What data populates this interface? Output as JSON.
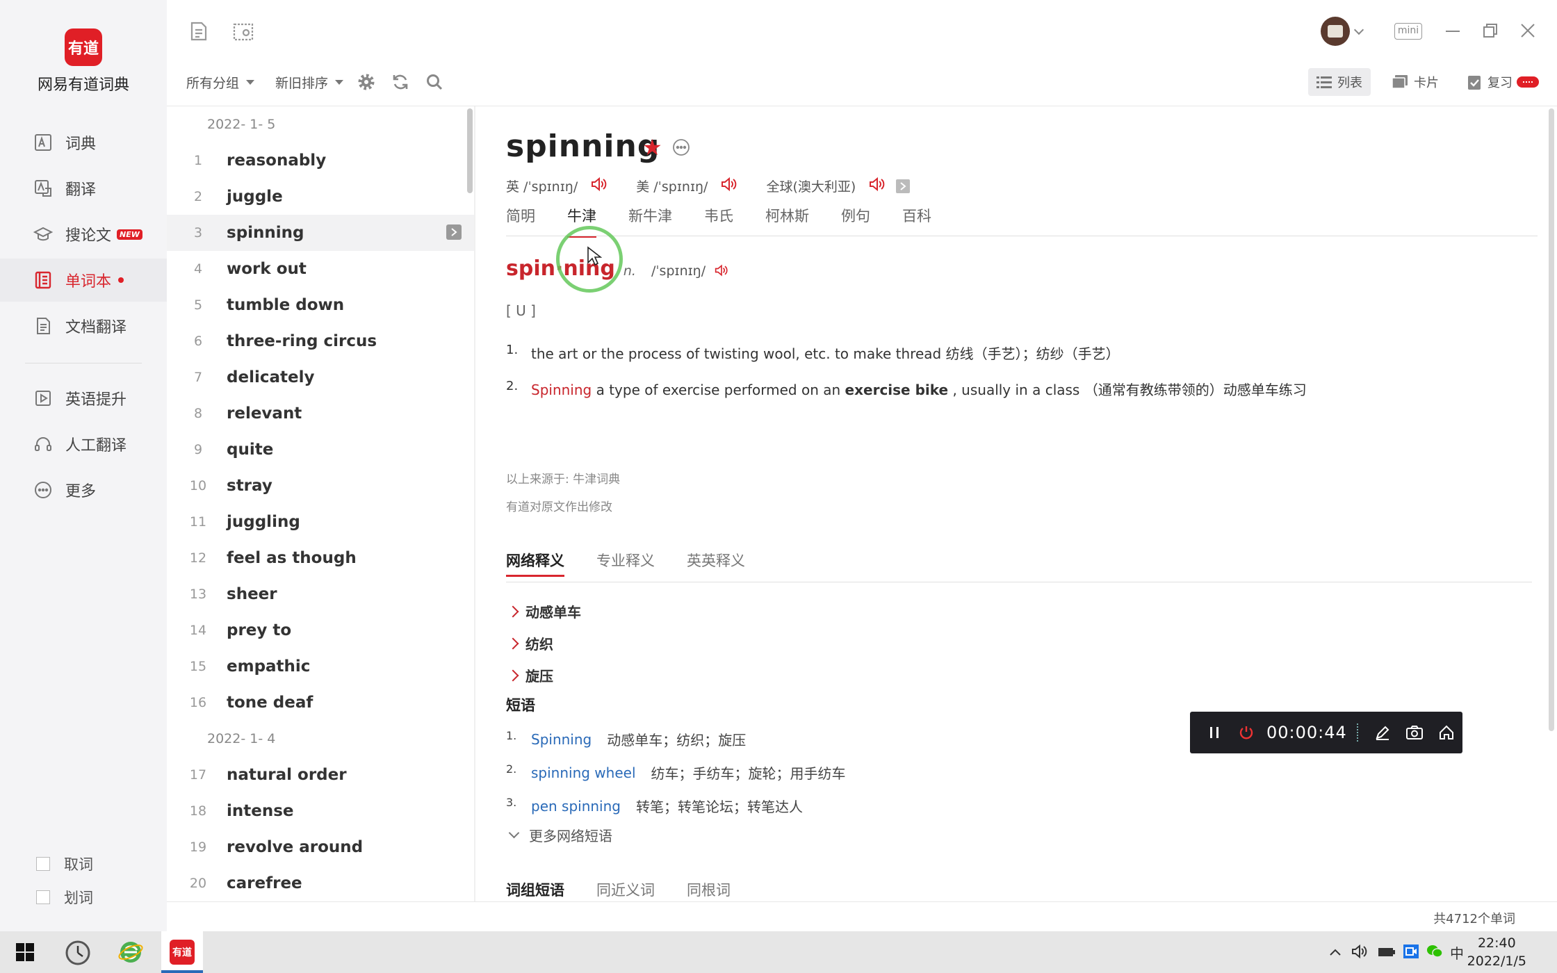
{
  "app": {
    "logo_text": "有道",
    "name": "网易有道词典"
  },
  "nav": {
    "items": [
      {
        "label": "词典",
        "icon": "dictionary-icon"
      },
      {
        "label": "翻译",
        "icon": "translate-icon"
      },
      {
        "label": "搜论文",
        "icon": "graduation-cap-icon",
        "badge": "NEW"
      },
      {
        "label": "单词本",
        "icon": "wordbook-icon",
        "active": true
      },
      {
        "label": "文档翻译",
        "icon": "document-icon"
      },
      {
        "label": "英语提升",
        "icon": "play-icon"
      },
      {
        "label": "人工翻译",
        "icon": "headset-icon"
      },
      {
        "label": "更多",
        "icon": "more-icon"
      }
    ],
    "checkboxes": [
      {
        "label": "取词"
      },
      {
        "label": "划词"
      }
    ]
  },
  "toolbar": {
    "group_filter": "所有分组",
    "sort": "新旧排序",
    "views": {
      "list": "列表",
      "card": "卡片",
      "review": "复习"
    },
    "mini": "mini"
  },
  "wordlist": {
    "groups": [
      {
        "date": "2022- 1- 5",
        "words": [
          {
            "n": "1",
            "w": "reasonably"
          },
          {
            "n": "2",
            "w": "juggle"
          },
          {
            "n": "3",
            "w": "spinning"
          },
          {
            "n": "4",
            "w": "work out"
          },
          {
            "n": "5",
            "w": "tumble down"
          },
          {
            "n": "6",
            "w": "three-ring circus"
          },
          {
            "n": "7",
            "w": "delicately"
          },
          {
            "n": "8",
            "w": "relevant"
          },
          {
            "n": "9",
            "w": "quite"
          },
          {
            "n": "10",
            "w": "stray"
          },
          {
            "n": "11",
            "w": "juggling"
          },
          {
            "n": "12",
            "w": "feel as though"
          },
          {
            "n": "13",
            "w": "sheer"
          },
          {
            "n": "14",
            "w": "prey to"
          },
          {
            "n": "15",
            "w": "empathic"
          },
          {
            "n": "16",
            "w": "tone deaf"
          }
        ]
      },
      {
        "date": "2022- 1- 4",
        "words": [
          {
            "n": "17",
            "w": "natural order"
          },
          {
            "n": "18",
            "w": "intense"
          },
          {
            "n": "19",
            "w": "revolve around"
          },
          {
            "n": "20",
            "w": "carefree"
          }
        ]
      }
    ],
    "selected_index": 2
  },
  "entry": {
    "word": "spinning",
    "phonetics": [
      {
        "label": "英 /ˈspɪnɪŋ/"
      },
      {
        "label": "美 /ˈspɪnɪŋ/"
      },
      {
        "label": "全球(澳大利亚)"
      }
    ],
    "dict_tabs": [
      "简明",
      "牛津",
      "新牛津",
      "韦氏",
      "柯林斯",
      "例句",
      "百科"
    ],
    "active_dict_tab": 1,
    "headword": "spin·ning",
    "pos": "n.",
    "hw_phonetic": "/ˈspɪnɪŋ/",
    "grammar": "[ U ]",
    "def1": {
      "num": "1.",
      "text": "the art or the process of twisting wool, etc. to make thread 纺线（手艺）；纺纱（手艺）"
    },
    "def2": {
      "num": "2.",
      "term": "Spinning",
      "text_a": " a type of exercise performed on an ",
      "bold": "exercise bike",
      "text_b": " , usually in a class （通常有教练带领的）动感单车练习"
    },
    "source1": "以上来源于: 牛津词典",
    "source2": "有道对原文作出修改",
    "net_tabs": [
      "网络释义",
      "专业释义",
      "英英释义"
    ],
    "net_items": [
      "动感单车",
      "纺织",
      "旋压"
    ],
    "phrases_title": "短语",
    "phrases": [
      {
        "num": "1.",
        "en": "Spinning",
        "zh": "动感单车；纺织；旋压"
      },
      {
        "num": "2.",
        "en": "spinning wheel",
        "zh": "纺车；手纺车；旋轮；用手纺车"
      },
      {
        "num": "3.",
        "en": "pen spinning",
        "zh": "转笔；转笔论坛；转笔达人"
      }
    ],
    "more_phrases": "更多网络短语",
    "bottom_tabs": [
      "词组短语",
      "同近义词",
      "同根词"
    ]
  },
  "recorder": {
    "time": "00:00:44"
  },
  "status": {
    "word_count": "共4712个单词"
  },
  "taskbar": {
    "time": "22:40",
    "date": "2022/1/5",
    "tray_ime": "中"
  },
  "colors": {
    "brand": "#e01f26",
    "accent_red": "#c8252c",
    "link_blue": "#2a6ab8"
  }
}
